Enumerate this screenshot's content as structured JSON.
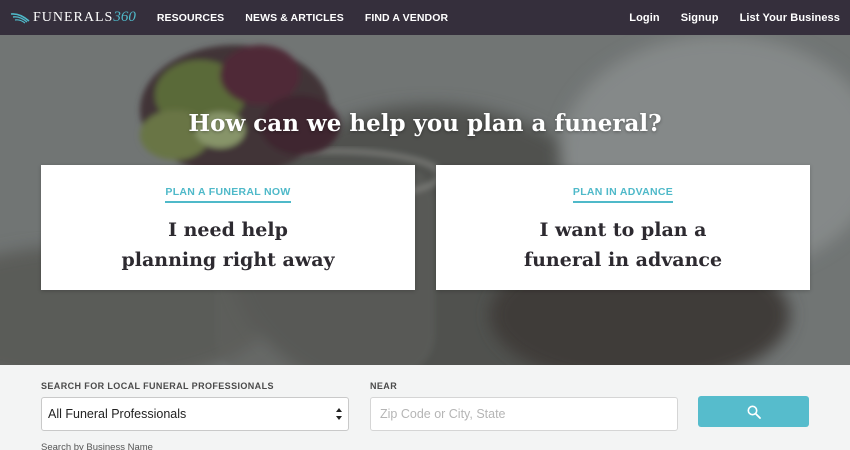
{
  "nav": {
    "logo_text": "FUNERALS",
    "logo_number": "360",
    "left_links": [
      "RESOURCES",
      "NEWS & ARTICLES",
      "FIND A VENDOR"
    ],
    "right_links": [
      "Login",
      "Signup",
      "List Your Business"
    ]
  },
  "hero": {
    "title": "How can we help you plan a funeral?",
    "cards": [
      {
        "kicker": "PLAN A FUNERAL NOW",
        "heading": "I need help\nplanning right away"
      },
      {
        "kicker": "PLAN IN ADVANCE",
        "heading": "I want to plan a\nfuneral in advance"
      }
    ]
  },
  "search": {
    "category_label": "SEARCH FOR LOCAL FUNERAL PROFESSIONALS",
    "category_value": "All Funeral Professionals",
    "near_label": "NEAR",
    "near_placeholder": "Zip Code or City, State",
    "button_icon": "search-icon",
    "business_name_link": "Search by Business Name"
  },
  "colors": {
    "nav_bg": "#352f3c",
    "accent": "#4fb9c9",
    "button": "#56bccc"
  }
}
